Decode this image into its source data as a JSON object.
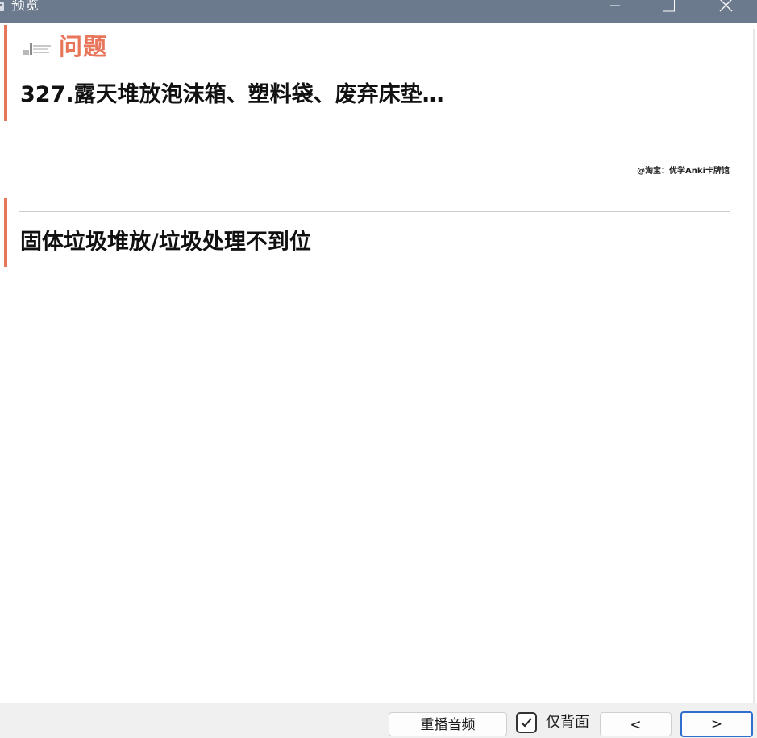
{
  "window": {
    "title": "预览",
    "titlebar_color": "#6b7a8c",
    "controls": [
      "minimize-icon",
      "maximize-icon",
      "close-icon"
    ]
  },
  "card": {
    "accent_color": "#e8765a",
    "question_label": "问题",
    "question_text": "327.露天堆放泡沫箱、塑料袋、废弃床垫…",
    "watermark": "@淘宝：优学Anki卡牌馆",
    "answer_text": "固体垃圾堆放/垃圾处理不到位"
  },
  "toolbar": {
    "replay_audio_label": "重播音频",
    "back_only_label": "仅背面",
    "back_only_checked": true,
    "prev_label": "<",
    "next_label": ">",
    "next_focus_color": "#2e6fce"
  }
}
